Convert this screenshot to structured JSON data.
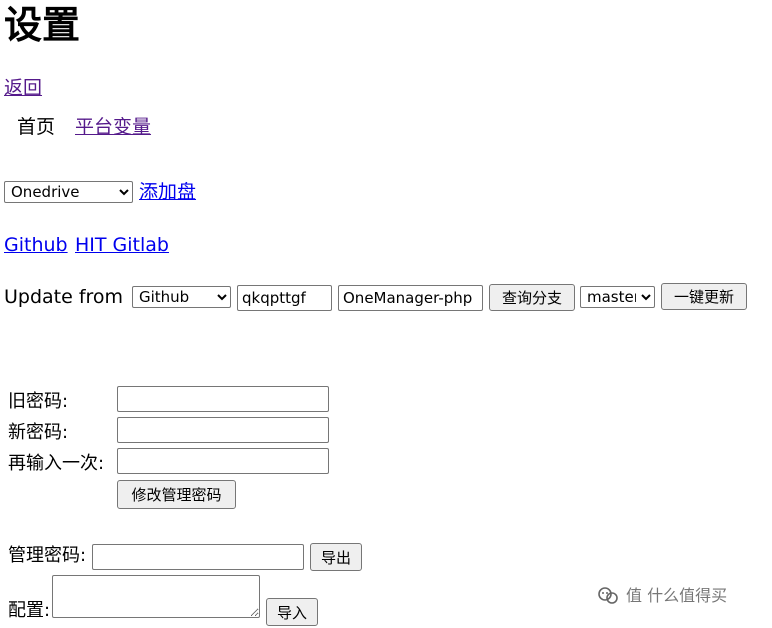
{
  "page_title": "设置",
  "back_link": "返回",
  "nav": {
    "home": "首页",
    "platform_vars": "平台变量"
  },
  "drive": {
    "selected": "Onedrive",
    "add_link": "添加盘"
  },
  "links": {
    "github": "Github",
    "hit_gitlab": "HIT Gitlab"
  },
  "update": {
    "label": "Update from",
    "source_selected": "Github",
    "user_value": "qkqpttgf",
    "repo_value": "OneManager-php",
    "query_branch_button": "查询分支",
    "branch_selected": "master",
    "one_click_update_button": "一键更新"
  },
  "password_form": {
    "old_label": "旧密码:",
    "new_label": "新密码:",
    "repeat_label": "再输入一次:",
    "submit_button": "修改管理密码"
  },
  "export": {
    "label": "管理密码:",
    "button": "导出"
  },
  "import": {
    "label": "配置:",
    "button": "导入"
  },
  "watermark": "值 什么值得买"
}
